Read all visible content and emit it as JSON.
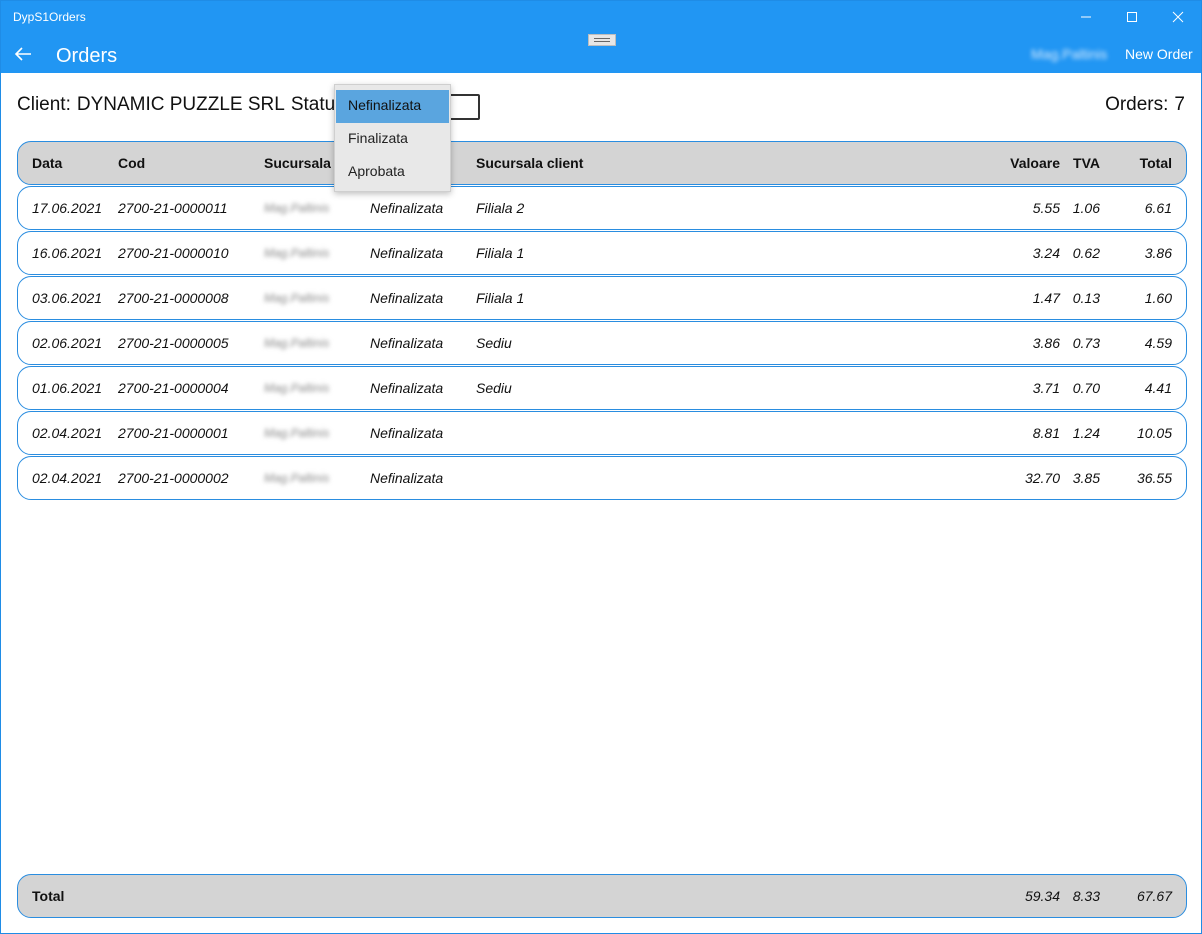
{
  "window": {
    "app_title": "DypS1Orders"
  },
  "header": {
    "page_title": "Orders",
    "user": "Mag.Paltinis",
    "new_order_label": "New Order"
  },
  "info": {
    "client_label": "Client:",
    "client_name": "DYNAMIC PUZZLE SRL",
    "status_label": "Status:",
    "orders_label": "Orders:",
    "orders_count": "7"
  },
  "status_dropdown": {
    "options": [
      "Nefinalizata",
      "Finalizata",
      "Aprobata"
    ],
    "selected": "Nefinalizata"
  },
  "table": {
    "columns": {
      "data": "Data",
      "cod": "Cod",
      "sucursala": "Sucursala",
      "sucursala_client": "Sucursala client",
      "valoare": "Valoare",
      "tva": "TVA",
      "total": "Total"
    },
    "rows": [
      {
        "data": "17.06.2021",
        "cod": "2700-21-0000011",
        "sucursala": "Mag.Paltinis",
        "status": "Nefinalizata",
        "sucursala_client": "Filiala 2",
        "valoare": "5.55",
        "tva": "1.06",
        "total": "6.61"
      },
      {
        "data": "16.06.2021",
        "cod": "2700-21-0000010",
        "sucursala": "Mag.Paltinis",
        "status": "Nefinalizata",
        "sucursala_client": "Filiala 1",
        "valoare": "3.24",
        "tva": "0.62",
        "total": "3.86"
      },
      {
        "data": "03.06.2021",
        "cod": "2700-21-0000008",
        "sucursala": "Mag.Paltinis",
        "status": "Nefinalizata",
        "sucursala_client": "Filiala 1",
        "valoare": "1.47",
        "tva": "0.13",
        "total": "1.60"
      },
      {
        "data": "02.06.2021",
        "cod": "2700-21-0000005",
        "sucursala": "Mag.Paltinis",
        "status": "Nefinalizata",
        "sucursala_client": "Sediu",
        "valoare": "3.86",
        "tva": "0.73",
        "total": "4.59"
      },
      {
        "data": "01.06.2021",
        "cod": "2700-21-0000004",
        "sucursala": "Mag.Paltinis",
        "status": "Nefinalizata",
        "sucursala_client": "Sediu",
        "valoare": "3.71",
        "tva": "0.70",
        "total": "4.41"
      },
      {
        "data": "02.04.2021",
        "cod": "2700-21-0000001",
        "sucursala": "Mag.Paltinis",
        "status": "Nefinalizata",
        "sucursala_client": "",
        "valoare": "8.81",
        "tva": "1.24",
        "total": "10.05"
      },
      {
        "data": "02.04.2021",
        "cod": "2700-21-0000002",
        "sucursala": "Mag.Paltinis",
        "status": "Nefinalizata",
        "sucursala_client": "",
        "valoare": "32.70",
        "tva": "3.85",
        "total": "36.55"
      }
    ],
    "footer": {
      "label": "Total",
      "valoare": "59.34",
      "tva": "8.33",
      "total": "67.67"
    }
  },
  "colors": {
    "accent": "#2196f3",
    "row_border": "#2a8de0",
    "header_bg": "#d4d4d4",
    "selected_option": "#5aa5df"
  }
}
